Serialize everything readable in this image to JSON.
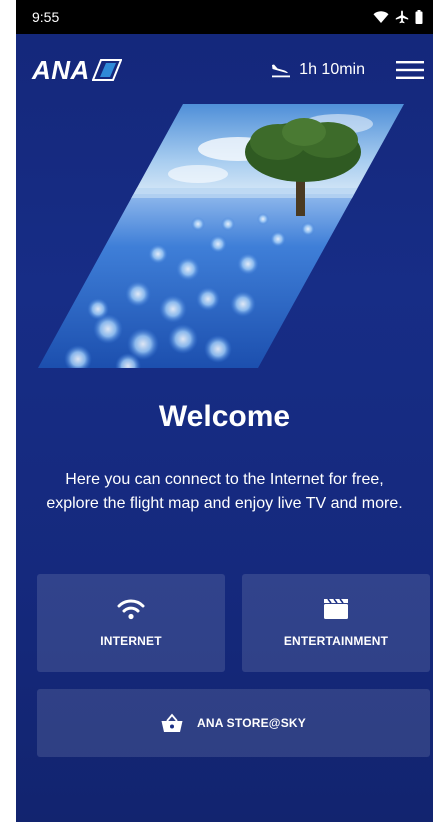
{
  "status_bar": {
    "time": "9:55",
    "icons": [
      "wifi-icon",
      "airplane-icon",
      "battery-icon"
    ]
  },
  "header": {
    "logo_text": "ANA",
    "flight_remaining": "1h 10min",
    "icons": [
      "landing-plane-icon",
      "hamburger-menu-icon"
    ]
  },
  "hero": {
    "image": "blue-flower-field-with-tree"
  },
  "welcome": {
    "title": "Welcome",
    "description": "Here you can connect to the Internet for free, explore the flight map and enjoy live TV and more."
  },
  "tiles": {
    "internet": {
      "label": "INTERNET",
      "icon": "wifi-icon"
    },
    "entertainment": {
      "label": "ENTERTAINMENT",
      "icon": "clapperboard-icon"
    },
    "store": {
      "label": "ANA STORE@SKY",
      "icon": "shopping-basket-icon"
    }
  },
  "colors": {
    "background": "#172d86",
    "logo_accent": "#2f8ad8",
    "tile_overlay": "rgba(255,255,255,0.12)",
    "text": "#ffffff"
  }
}
